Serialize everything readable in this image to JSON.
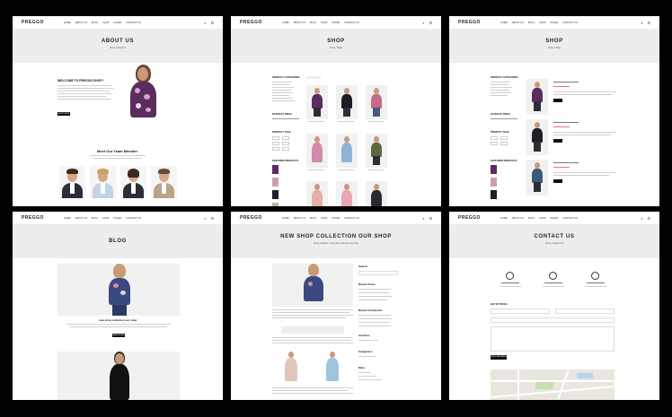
{
  "brand": "PREGGO",
  "nav": {
    "items": [
      "HOME",
      "ABOUT US",
      "BLOG",
      "SHOP",
      "PAGES",
      "CONTACT US"
    ],
    "cart_icon": "cart-icon",
    "search_icon": "search-icon"
  },
  "about": {
    "title": "ABOUT US",
    "breadcrumb": "Home  /  About Us",
    "welcome": "WELCOME TO PREGGO SHOP !",
    "button": "SHOP NOW",
    "team_title": "Meet Our Team Member"
  },
  "shop": {
    "title": "SHOP",
    "breadcrumb": "Home  /  Shop",
    "sidebar": {
      "categories": "PRODUCT CATEGORIES",
      "filter": "FILTER BY PRICE",
      "tags": "PRODUCT TAGS",
      "featured": "FEATURED PRODUCTS"
    }
  },
  "blog": {
    "title": "BLOG",
    "post_title": "new shop collection our shop",
    "button": "READ MORE"
  },
  "post": {
    "title": "NEW SHOP COLLECTION OUR SHOP",
    "breadcrumb": "Home  /  Fashion  /  New shop collection our shop",
    "sidebar": [
      "Search",
      "Recent Posts",
      "Recent Comments",
      "Archives",
      "Categories",
      "Meta"
    ]
  },
  "contact": {
    "title": "CONTACT US",
    "breadcrumb": "Home  /  Contact Us",
    "form_title": "GET IN TOUCH",
    "button": "SEND MESSAGE"
  },
  "colors": {
    "accent_dress": "#5b2c5e",
    "floral": "#d9a3c4",
    "dark": "#111111",
    "hero_bg": "#ededed"
  }
}
